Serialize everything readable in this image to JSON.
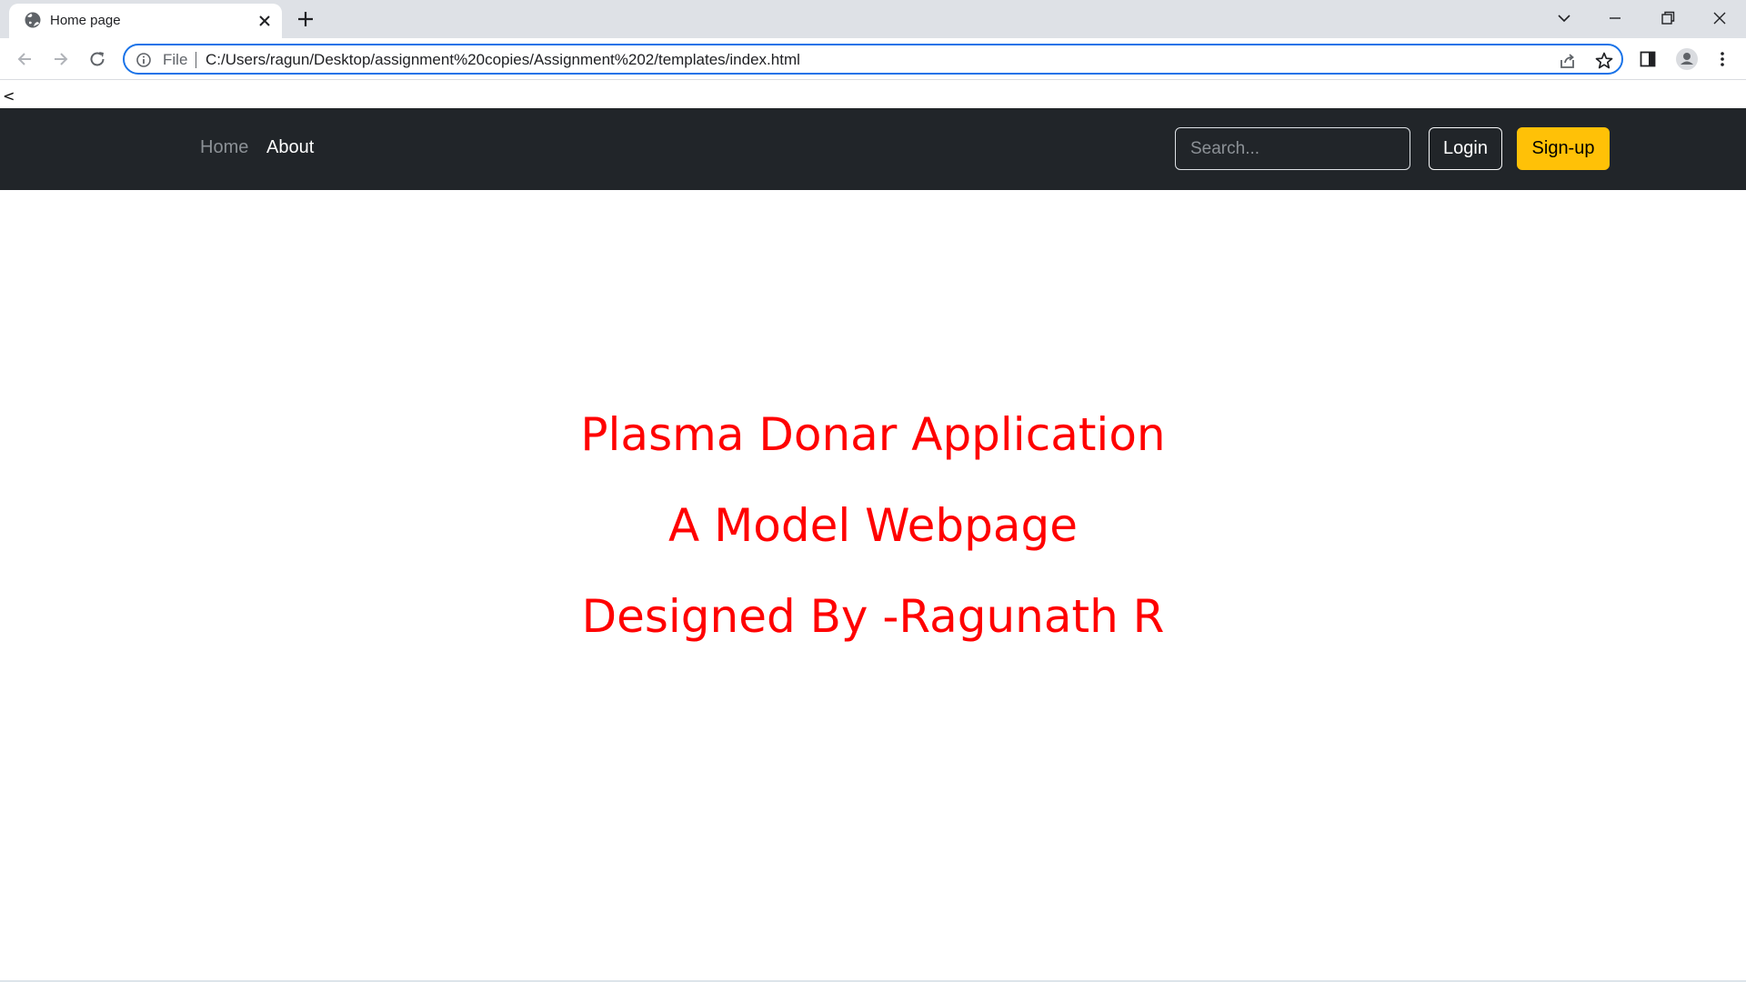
{
  "browser": {
    "tab": {
      "title": "Home page"
    },
    "address_bar": {
      "scheme_label": "File",
      "url": "C:/Users/ragun/Desktop/assignment%20copies/Assignment%202/templates/index.html"
    },
    "icons": [
      "globe-icon",
      "close-icon",
      "plus-icon",
      "chevron-down-icon",
      "minimize-icon",
      "restore-icon",
      "window-close-icon",
      "back-arrow-icon",
      "forward-arrow-icon",
      "reload-icon",
      "info-icon",
      "share-icon",
      "star-icon",
      "side-panel-icon",
      "profile-icon",
      "kebab-menu-icon"
    ]
  },
  "page": {
    "stray_text": "<",
    "navbar": {
      "links": [
        {
          "label": "Home"
        },
        {
          "label": "About"
        }
      ],
      "search": {
        "placeholder": "Search..."
      },
      "login_label": "Login",
      "signup_label": "Sign-up"
    },
    "hero": {
      "line1": "Plasma Donar Application",
      "line2": "A Model Webpage",
      "line3": "Designed By -Ragunath R"
    }
  },
  "colors": {
    "navbar_bg": "#212529",
    "hero_text": "#ff0000",
    "signup_bg": "#ffc107",
    "omnibox_border": "#1a73e8",
    "tabstrip_bg": "#dee1e6"
  }
}
